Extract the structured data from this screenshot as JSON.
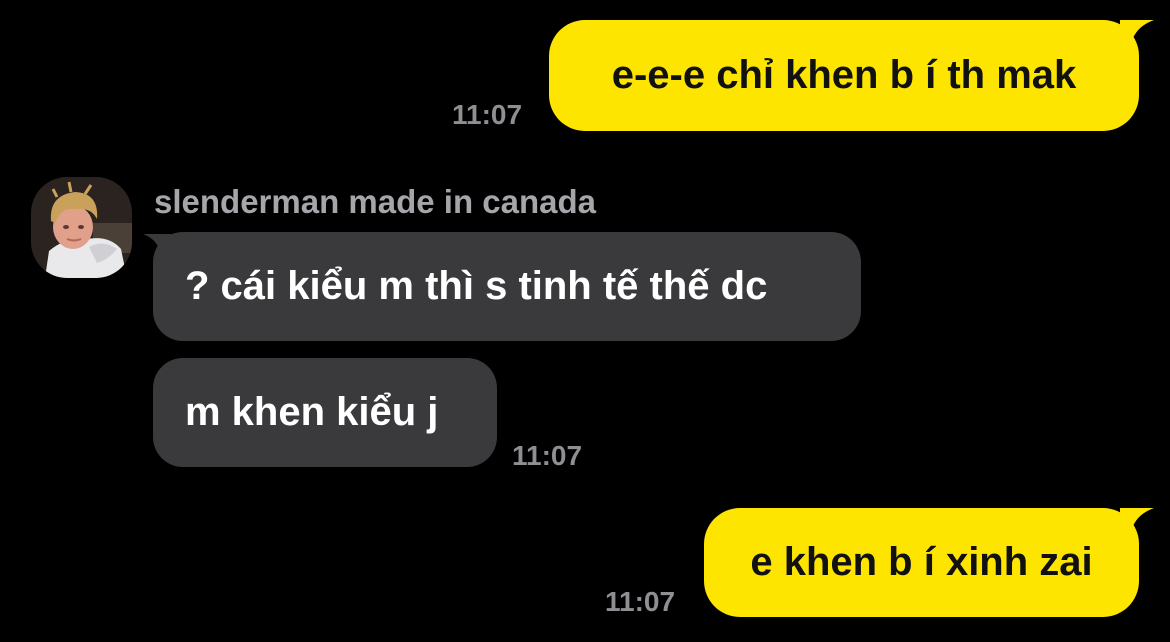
{
  "chat": {
    "messages": [
      {
        "direction": "outgoing",
        "text": "e-e-e chỉ khen b í th mak",
        "time": "11:07"
      },
      {
        "direction": "incoming",
        "sender": "slenderman made in canada",
        "text": "? cái kiểu m thì s tinh tế thế dc"
      },
      {
        "direction": "incoming",
        "text": "m khen kiểu j",
        "time": "11:07"
      },
      {
        "direction": "outgoing",
        "text": "e khen b í xinh zai",
        "time": "11:07"
      }
    ]
  },
  "colors": {
    "background": "#000000",
    "outgoing_bubble": "#FEE500",
    "incoming_bubble": "#3A3A3C",
    "timestamp": "#8E8E93",
    "sender_name": "#A5A5AA"
  }
}
